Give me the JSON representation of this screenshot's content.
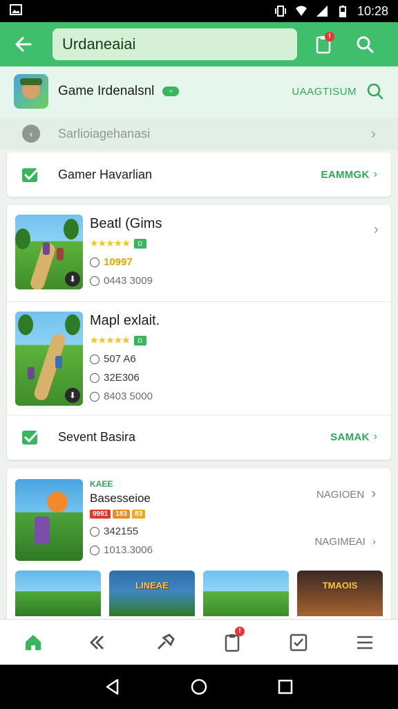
{
  "status_bar": {
    "time": "10:28"
  },
  "app_bar": {
    "search_value": "Urdaneaiai",
    "notification_count": "!"
  },
  "game_header": {
    "title": "Game Irdenalsnl",
    "pill": "+",
    "action": "UAAGTISUM"
  },
  "sub_row": {
    "label": "Sarlioiagehanasi"
  },
  "card1": {
    "label": "Gamer Havarlian",
    "link": "EAMMGK"
  },
  "games": [
    {
      "name": "Beatl (Gims",
      "tag": "D",
      "price": "10997",
      "meta2": "0443 3009"
    },
    {
      "name": "Mapl exlait.",
      "tag": "D",
      "price": "507 A6",
      "meta2": "32E306",
      "meta3": "8403 5000"
    }
  ],
  "card2_row": {
    "label": "Sevent Basira",
    "link": "SAMAK"
  },
  "featured": {
    "kicker": "KAEE",
    "name": "Basesseioe",
    "chips": [
      "9991",
      "183",
      "83"
    ],
    "meta1": "342155",
    "meta2": "1013.3006",
    "right1": "NAGIOEN",
    "right2": "NAGIMEAI"
  },
  "thumbs": [
    {
      "text": ""
    },
    {
      "text": "LINEAE"
    },
    {
      "text": ""
    },
    {
      "text": "TMAOIS"
    }
  ],
  "colors": {
    "accent": "#3fbf6b",
    "link": "#2ea857",
    "star": "#f5c518"
  }
}
